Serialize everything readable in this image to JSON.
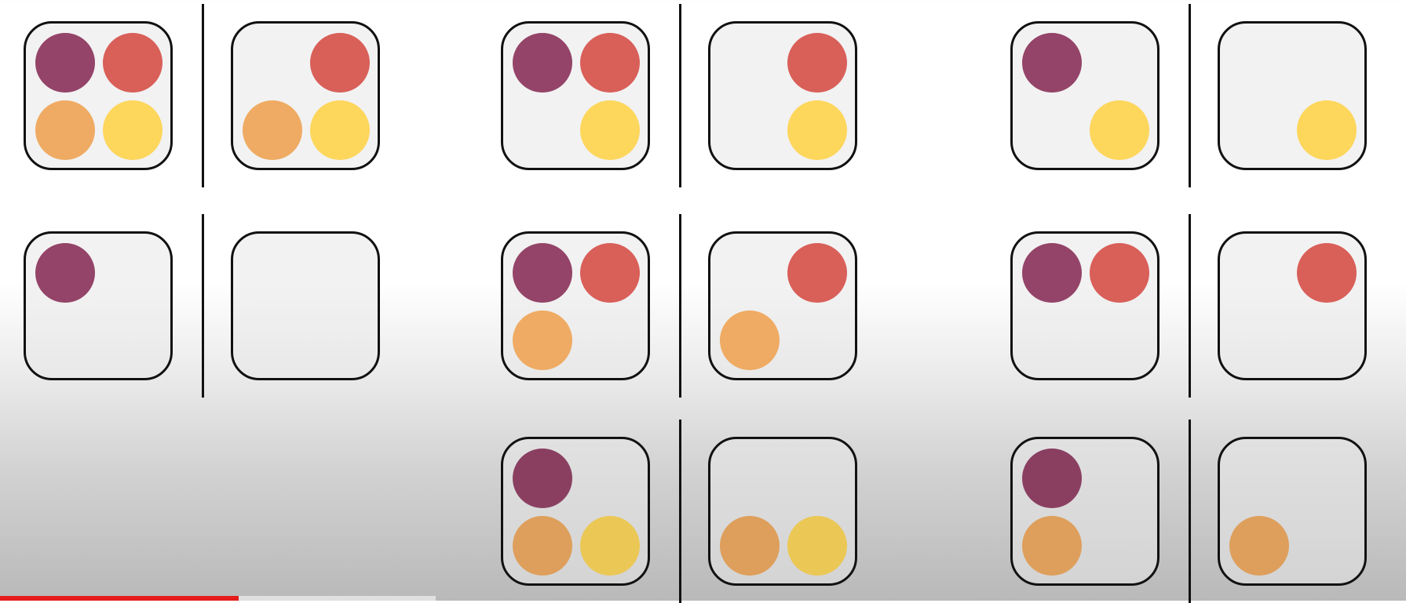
{
  "colors": {
    "purple": "#944468",
    "red": "#d95f59",
    "orange": "#efab63",
    "yellow": "#fdd65c",
    "outline": "#111111",
    "progress_played": "#e61b1b",
    "progress_buffered": "#ffffff"
  },
  "slot_order": [
    "purple",
    "red",
    "orange",
    "yellow"
  ],
  "panels": [
    {
      "row": 1,
      "column": 1,
      "left_set": [
        "purple",
        "red",
        "orange",
        "yellow"
      ],
      "right_set": [
        "red",
        "orange",
        "yellow"
      ]
    },
    {
      "row": 1,
      "column": 2,
      "left_set": [
        "purple",
        "red",
        "yellow"
      ],
      "right_set": [
        "red",
        "yellow"
      ]
    },
    {
      "row": 1,
      "column": 3,
      "left_set": [
        "purple",
        "yellow"
      ],
      "right_set": [
        "yellow"
      ]
    },
    {
      "row": 2,
      "column": 1,
      "left_set": [
        "purple"
      ],
      "right_set": []
    },
    {
      "row": 2,
      "column": 2,
      "left_set": [
        "purple",
        "red",
        "orange"
      ],
      "right_set": [
        "red",
        "orange"
      ]
    },
    {
      "row": 2,
      "column": 3,
      "left_set": [
        "purple",
        "red"
      ],
      "right_set": [
        "red"
      ]
    },
    {
      "row": 3,
      "column": 2,
      "left_set": [
        "purple",
        "orange",
        "yellow"
      ],
      "right_set": [
        "orange",
        "yellow"
      ]
    },
    {
      "row": 3,
      "column": 3,
      "left_set": [
        "purple",
        "orange"
      ],
      "right_set": [
        "orange"
      ]
    }
  ],
  "video_progress": {
    "played_fraction": 0.17,
    "buffered_fraction": 0.31
  }
}
